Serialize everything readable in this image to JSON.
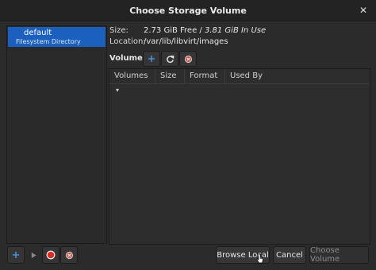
{
  "window": {
    "title": "Choose Storage Volume"
  },
  "pools": [
    {
      "name": "default",
      "type": "Filesystem Directory",
      "selected": true
    }
  ],
  "info": {
    "size_label": "Size:",
    "size_free": "2.73 GiB Free / ",
    "size_use": "3.81 GiB In Use",
    "location_label": "Location:",
    "location_value": "/var/lib/libvirt/images"
  },
  "volumes": {
    "label": "Volumes",
    "columns": [
      "Volumes",
      "Size",
      "Format",
      "Used By"
    ],
    "sort_indicator": "▾",
    "rows": []
  },
  "buttons": {
    "browse_local": "Browse Local",
    "cancel": "Cancel",
    "choose_volume": "Choose Volume"
  },
  "icons": {
    "add_volume": "add-icon",
    "refresh": "refresh-icon",
    "delete_volume": "delete-icon",
    "add_pool": "add-icon",
    "start_pool": "play-icon",
    "stop_pool": "stop-icon",
    "delete_pool": "delete-icon"
  },
  "colors": {
    "selection": "#1b5fbf",
    "accent_add": "#4a90d9",
    "stop_red": "#e0281e"
  }
}
